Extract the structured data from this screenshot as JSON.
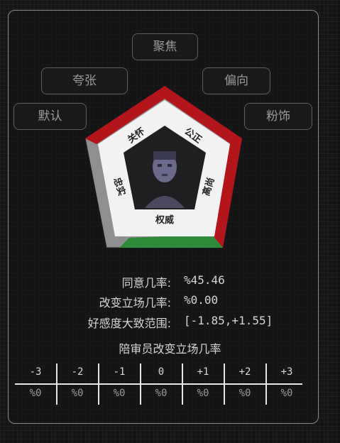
{
  "tags": {
    "focus": "聚焦",
    "exaggerate": "夸张",
    "bias": "偏向",
    "default": "默认",
    "embellish": "粉饰"
  },
  "wheel": {
    "top_left": "关怀",
    "top_right": "公正",
    "left": "忠实",
    "right": "高尚",
    "bottom": "权威",
    "colors": {
      "red": "#b3151b",
      "green": "#2e8b3a",
      "gray": "#8f8f8f",
      "white": "#f2f2f2"
    }
  },
  "stats": {
    "agree_label": "同意几率:",
    "agree_value": "%45.46",
    "change_label": "改变立场几率:",
    "change_value": "%0.00",
    "favor_label": "好感度大致范围:",
    "favor_value": "[-1.85,+1.55]"
  },
  "juror": {
    "title": "陪审员改变立场几率",
    "headers": [
      "-3",
      "-2",
      "-1",
      "0",
      "+1",
      "+2",
      "+3"
    ],
    "values": [
      "%0",
      "%0",
      "%0",
      "%0",
      "%0",
      "%0",
      "%0"
    ]
  }
}
